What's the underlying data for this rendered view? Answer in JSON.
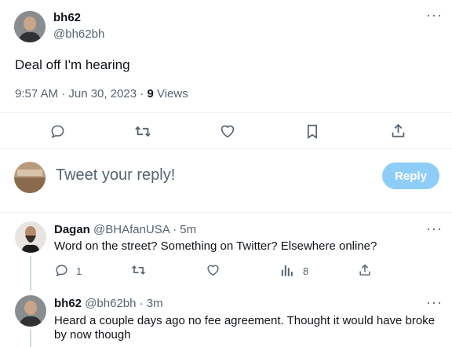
{
  "main_tweet": {
    "display_name": "bh62",
    "handle": "@bh62bh",
    "text": "Deal off I'm hearing",
    "timestamp": "9:57 AM · Jun 30, 2023 ·",
    "views_count": "9",
    "views_label": "Views",
    "more_icon": "more-icon"
  },
  "actions": [
    "reply-icon",
    "retweet-icon",
    "like-icon",
    "bookmark-icon",
    "share-icon"
  ],
  "reply_box": {
    "placeholder": "Tweet your reply!",
    "button_label": "Reply",
    "button_color": "#8ecdf8"
  },
  "replies": [
    {
      "display_name": "Dagan",
      "handle": "@BHAfanUSA",
      "time": "· 5m",
      "text": "Word on the street? Something on Twitter? Elsewhere online?",
      "reply_count": "1",
      "views_count": "8"
    },
    {
      "display_name": "bh62",
      "handle": "@bh62bh",
      "time": "· 3m",
      "text": "Heard a couple days ago no fee agreement. Thought it would have broke by now though"
    }
  ],
  "colors": {
    "text": "#0f1419",
    "muted": "#536471",
    "accent": "#1d9bf0",
    "divider": "#eff3f4"
  }
}
